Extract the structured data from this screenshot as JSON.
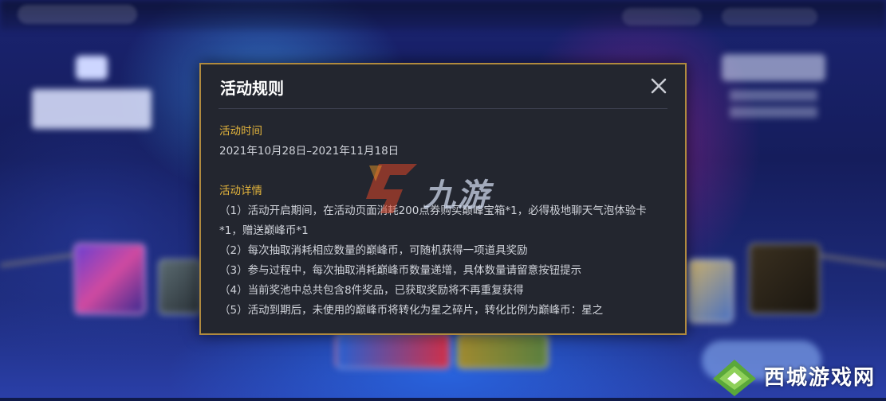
{
  "modal": {
    "title": "活动规则",
    "time_heading": "活动时间",
    "time_value": "2021年10月28日–2021年11月18日",
    "details_heading": "活动详情",
    "rules": [
      "（1）活动开启期间，在活动页面消耗200点券购买巅峰宝箱*1，必得极地聊天气泡体验卡*1，赠送巅峰币*1",
      "（2）每次抽取消耗相应数量的巅峰币，可随机获得一项道具奖励",
      "（3）参与过程中，每次抽取消耗巅峰币数量递增，具体数量请留意按钮提示",
      "（4）当前奖池中总共包含8件奖品，已获取奖励将不再重复获得",
      "（5）活动到期后，未使用的巅峰币将转化为星之碎片，转化比例为巅峰币：星之"
    ]
  },
  "watermark_center": "九游",
  "watermark_corner": "西城游戏网",
  "colors": {
    "accent_gold": "#e3b43c",
    "modal_border": "#b08a3e",
    "modal_bg": "#23262f"
  },
  "icons": {
    "close": "close-icon"
  }
}
